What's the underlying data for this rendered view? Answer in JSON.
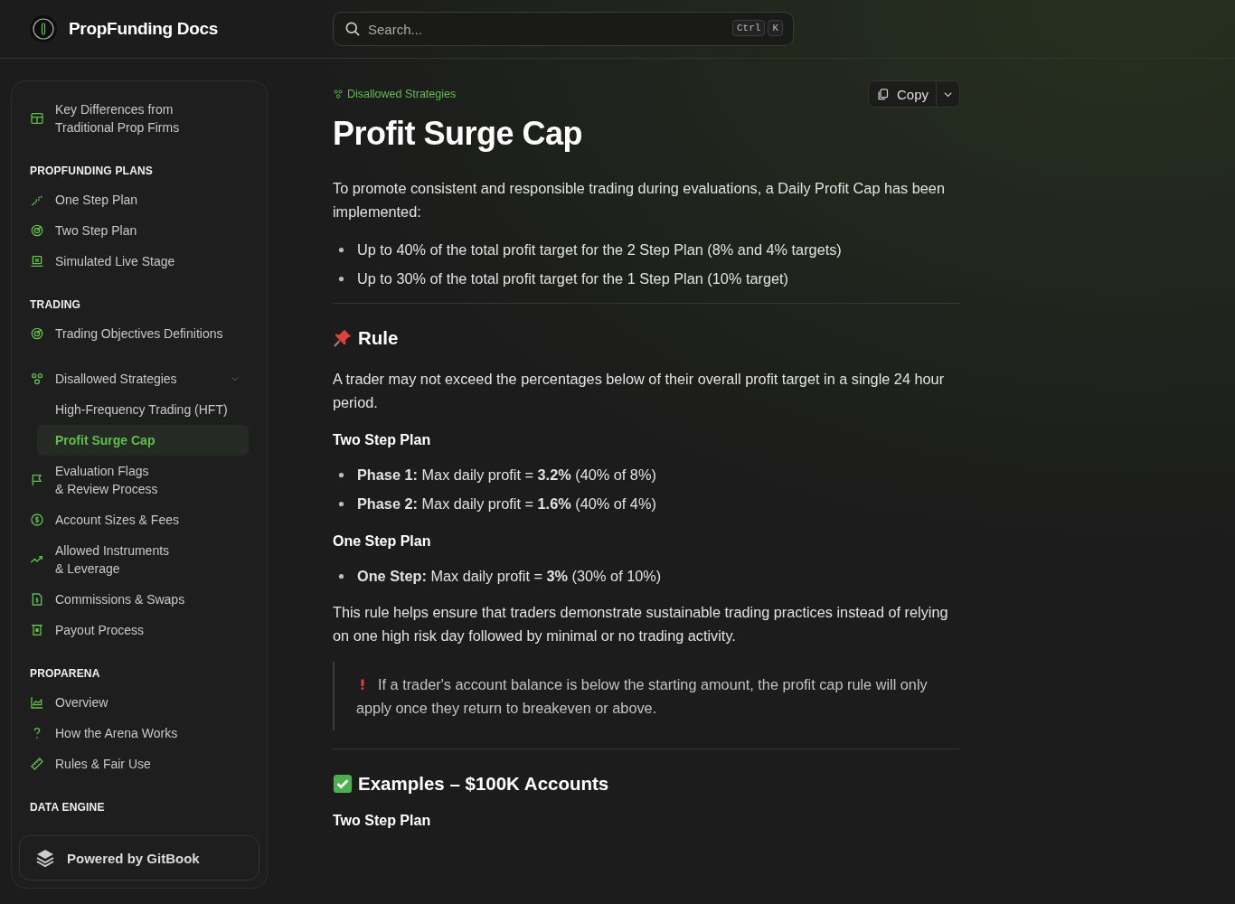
{
  "header": {
    "site_title": "PropFunding Docs",
    "search": {
      "placeholder": "Search...",
      "shortcut": [
        "Ctrl",
        "K"
      ]
    }
  },
  "sidebar": {
    "items": [
      {
        "kind": "link",
        "label": "Key Differences from\nTraditional Prop Firms",
        "selected": false
      },
      {
        "kind": "section",
        "label": "PROPFUNDING PLANS"
      },
      {
        "kind": "link",
        "label": "One Step Plan",
        "selected": false
      },
      {
        "kind": "link",
        "label": "Two Step Plan",
        "selected": false
      },
      {
        "kind": "link",
        "label": "Simulated Live Stage",
        "selected": false
      },
      {
        "kind": "section",
        "label": "TRADING"
      },
      {
        "kind": "link",
        "label": "Trading Objectives Definitions",
        "selected": false
      },
      {
        "kind": "group",
        "label": "Disallowed Strategies",
        "expanded": true,
        "children": [
          {
            "label": "High-Frequency Trading (HFT)",
            "selected": false
          },
          {
            "label": "Profit Surge Cap",
            "selected": true
          }
        ]
      },
      {
        "kind": "link",
        "label": "Evaluation Flags\n& Review Process",
        "selected": false
      },
      {
        "kind": "link",
        "label": "Account Sizes & Fees",
        "selected": false
      },
      {
        "kind": "link",
        "label": "Allowed Instruments\n& Leverage",
        "selected": false
      },
      {
        "kind": "link",
        "label": "Commissions & Swaps",
        "selected": false
      },
      {
        "kind": "link",
        "label": "Payout Process",
        "selected": false
      },
      {
        "kind": "section",
        "label": "PROPARENA"
      },
      {
        "kind": "link",
        "label": "Overview",
        "selected": false
      },
      {
        "kind": "link",
        "label": "How the Arena Works",
        "selected": false
      },
      {
        "kind": "link",
        "label": "Rules & Fair Use",
        "selected": false
      },
      {
        "kind": "section",
        "label": "DATA ENGINE"
      }
    ],
    "footer": "Powered by GitBook"
  },
  "page": {
    "breadcrumb": "Disallowed Strategies",
    "copy_button": "Copy",
    "title": "Profit Surge Cap",
    "blocks": [
      {
        "kind": "paragraph",
        "text": "To promote consistent and responsible trading during evaluations, a Daily Profit Cap has been implemented:"
      },
      {
        "kind": "bullets",
        "items": [
          "Up to 40% of the total profit target for the 2 Step Plan (8% and 4% targets)",
          "Up to 30% of the total profit target for the 1 Step Plan (10% target)"
        ]
      },
      {
        "kind": "divider"
      },
      {
        "kind": "heading",
        "text": "Rule"
      },
      {
        "kind": "paragraph",
        "text": "A trader may not exceed the percentages below of their overall profit target in a single 24 hour period."
      },
      {
        "kind": "subheading",
        "text": "Two Step Plan"
      },
      {
        "kind": "bullets",
        "items": [
          "**Phase 1:** Max daily profit = **3.2%** (40% of 8%)",
          "**Phase 2:** Max daily profit = **1.6%** (40% of 4%)"
        ]
      },
      {
        "kind": "subheading",
        "text": "One Step Plan"
      },
      {
        "kind": "bullets",
        "items": [
          "**One Step:** Max daily profit = **3%** (30% of 10%)"
        ]
      },
      {
        "kind": "paragraph",
        "text": "This rule helps ensure that traders demonstrate sustainable trading practices instead of relying on one high risk day followed by minimal or no trading activity."
      },
      {
        "kind": "quote",
        "text": "If a trader's account balance is below the starting amount, the profit cap rule will only apply once they return to breakeven or above."
      },
      {
        "kind": "divider"
      },
      {
        "kind": "heading",
        "text": "Examples – $100K Accounts"
      },
      {
        "kind": "subheading",
        "text": "Two Step Plan"
      }
    ]
  }
}
